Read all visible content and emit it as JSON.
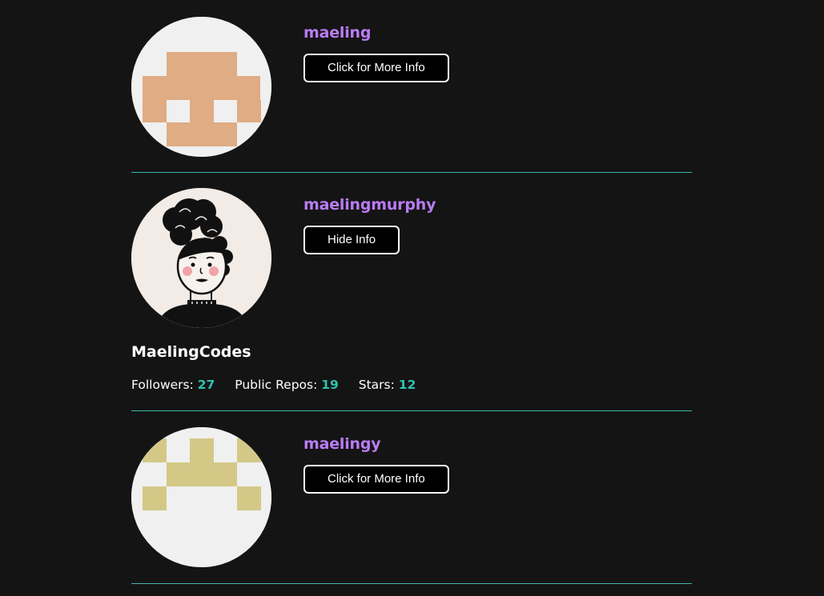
{
  "colors": {
    "background": "#141414",
    "username": "#b97cf6",
    "divider": "#3fb7a8",
    "stat_value": "#2fc3b0"
  },
  "users": [
    {
      "username": "maeling",
      "button_label": "Click for More Info",
      "avatar": "pixel-identicon-peach-icon"
    },
    {
      "username": "maelingmurphy",
      "button_label": "Hide Info",
      "avatar": "illustrated-portrait-icon",
      "details": {
        "display_name": "MaelingCodes",
        "followers_label": "Followers:",
        "followers": "27",
        "repos_label": "Public Repos:",
        "repos": "19",
        "stars_label": "Stars:",
        "stars": "12"
      }
    },
    {
      "username": "maelingy",
      "button_label": "Click for More Info",
      "avatar": "pixel-identicon-gold-icon"
    }
  ]
}
